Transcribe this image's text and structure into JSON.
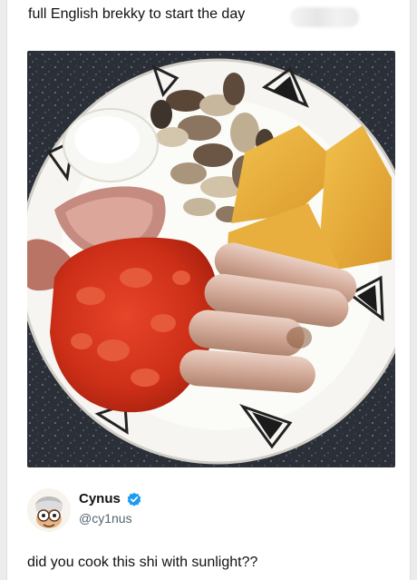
{
  "post": {
    "caption": "full English brekky to start the day"
  },
  "reply": {
    "user": {
      "display_name": "Cynus",
      "handle": "@cy1nus",
      "verified": true
    },
    "text": "did you cook this shi with sunlight??"
  },
  "icons": {
    "verified": "verified-badge-icon",
    "avatar": "cartoon-avatar"
  },
  "colors": {
    "verified_badge": "#1d9bf0",
    "handle_text": "#536471",
    "text": "#111111"
  }
}
